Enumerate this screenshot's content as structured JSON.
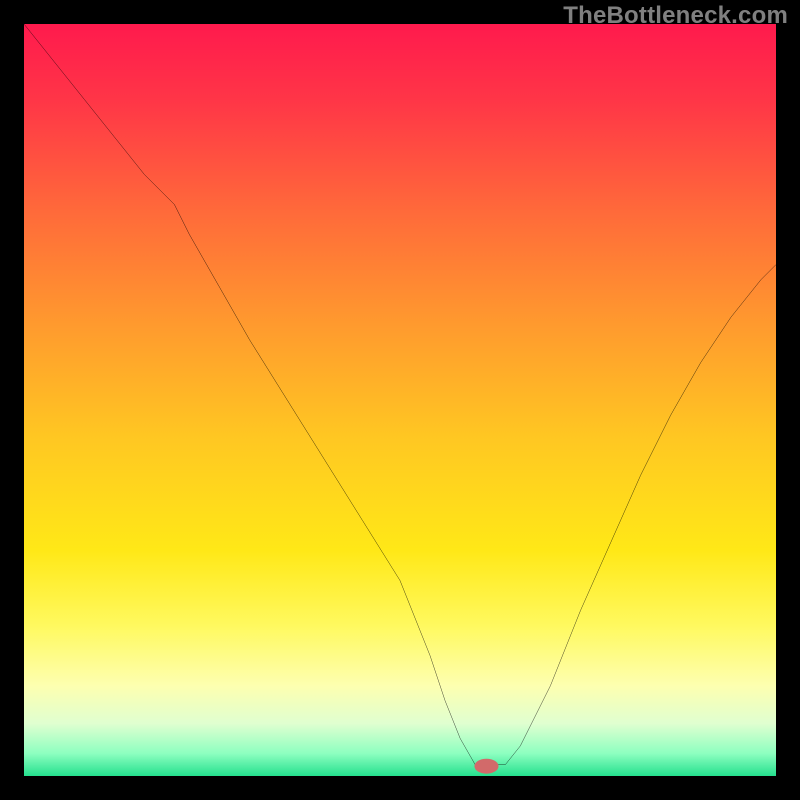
{
  "watermark": "TheBottleneck.com",
  "chart_data": {
    "type": "line",
    "title": "",
    "xlabel": "",
    "ylabel": "",
    "xlim": [
      0,
      100
    ],
    "ylim": [
      0,
      100
    ],
    "grid": false,
    "legend": false,
    "background": {
      "type": "vertical-gradient",
      "stops": [
        {
          "offset": 0.0,
          "color": "#ff1a4d"
        },
        {
          "offset": 0.1,
          "color": "#ff3547"
        },
        {
          "offset": 0.25,
          "color": "#ff6a3a"
        },
        {
          "offset": 0.4,
          "color": "#ff9a2e"
        },
        {
          "offset": 0.55,
          "color": "#ffc722"
        },
        {
          "offset": 0.7,
          "color": "#ffe817"
        },
        {
          "offset": 0.8,
          "color": "#fff95f"
        },
        {
          "offset": 0.88,
          "color": "#fdffb0"
        },
        {
          "offset": 0.93,
          "color": "#e0ffd0"
        },
        {
          "offset": 0.97,
          "color": "#8dffc0"
        },
        {
          "offset": 1.0,
          "color": "#25e08e"
        }
      ]
    },
    "series": [
      {
        "name": "bottleneck-curve",
        "color": "#000000",
        "width": 2.2,
        "x": [
          0,
          4,
          8,
          12,
          16,
          20,
          22,
          26,
          30,
          35,
          40,
          45,
          50,
          54,
          56,
          58,
          60,
          62,
          64,
          66,
          70,
          74,
          78,
          82,
          86,
          90,
          94,
          98,
          100
        ],
        "y": [
          100,
          95,
          90,
          85,
          80,
          76,
          72,
          65,
          58,
          50,
          42,
          34,
          26,
          16,
          10,
          5,
          1.5,
          1.5,
          1.5,
          4,
          12,
          22,
          31,
          40,
          48,
          55,
          61,
          66,
          68
        ]
      }
    ],
    "marker": {
      "name": "minimum-marker",
      "cx": 61.5,
      "cy": 1.3,
      "rx": 1.6,
      "ry": 1.0,
      "color": "#d26a6a"
    }
  }
}
